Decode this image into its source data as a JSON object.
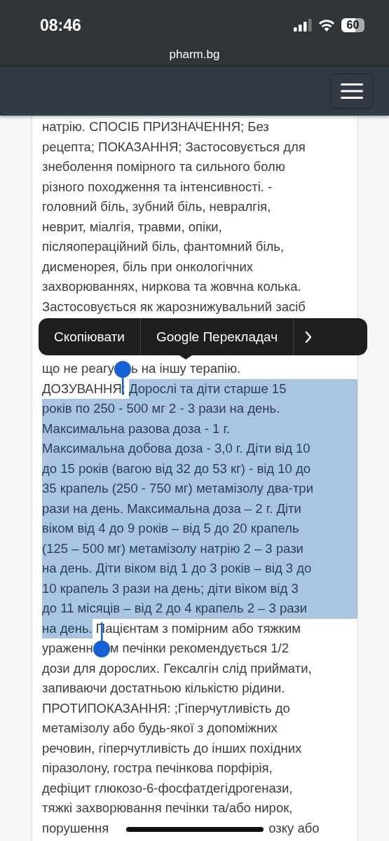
{
  "status_bar": {
    "time": "08:46",
    "battery": "60"
  },
  "browser": {
    "url": "pharm.bg"
  },
  "text_before_menu": [
    [
      {
        "text": "натрію. СПОСІБ ПРИЗНАЧЕННЯ; Без",
        "selected": false
      }
    ],
    [
      {
        "text": "рецепта; ПОКАЗАННЯ; Застосовується для",
        "selected": false
      }
    ],
    [
      {
        "text": "знеболення помірного та сильного болю",
        "selected": false
      }
    ],
    [
      {
        "text": "різного походження та інтенсивності. -",
        "selected": false
      }
    ],
    [
      {
        "text": "головний біль, зубний біль, невралгія,",
        "selected": false
      }
    ],
    [
      {
        "text": "неврит, міалгія, травми, опіки,",
        "selected": false
      }
    ],
    [
      {
        "text": "післяопераційний біль, фантомний біль,",
        "selected": false
      }
    ],
    [
      {
        "text": "дисменорея, біль при онкологічних",
        "selected": false
      }
    ],
    [
      {
        "text": "захворюваннях, ниркова та жовчна колька.",
        "selected": false
      }
    ],
    [
      {
        "text": "Застосовується як жарознижувальний засіб",
        "selected": false
      }
    ]
  ],
  "context_menu": {
    "items": [
      {
        "label": "Скопіювати"
      },
      {
        "label": "Google Перекладач"
      }
    ]
  },
  "text_after_menu": [
    [
      {
        "text": "що не реагу",
        "selected": false
      },
      {
        "text": "ь на іншу терапію.",
        "selected": false
      }
    ],
    [
      {
        "text": "ДОЗУВАННЯ; ",
        "selected": false
      },
      {
        "text": "Дорослі та діти старше 15",
        "selected": true
      }
    ],
    [
      {
        "text": "років по 250 - 500 мг 2 - 3 рази на день.",
        "selected": true
      }
    ],
    [
      {
        "text": "Максимальна разова доза - 1 г.",
        "selected": true
      }
    ],
    [
      {
        "text": "Максимальна добова доза - 3,0 г. Діти від 10",
        "selected": true
      }
    ],
    [
      {
        "text": "до 15 років (вагою від 32 до 53 кг) - від 10 до",
        "selected": true
      }
    ],
    [
      {
        "text": "35 крапель (250 - 750 мг) метамізолу два-три",
        "selected": true
      }
    ],
    [
      {
        "text": "рази на день. Максимальна доза – 2 г. Діти",
        "selected": true
      }
    ],
    [
      {
        "text": "віком від 4 до 9 років – від 5 до 20 крапель",
        "selected": true
      }
    ],
    [
      {
        "text": "(125 – 500 мг) метамізолу натрію 2 – 3 рази",
        "selected": true
      }
    ],
    [
      {
        "text": "на день. Діти віком від 1 до 3 років – від 3 до",
        "selected": true
      }
    ],
    [
      {
        "text": "10 крапель 3 рази на день; діти віком від 3",
        "selected": true
      }
    ],
    [
      {
        "text": "до 11 місяців – від 2 до 4 крапель 2 – 3 рази",
        "selected": true
      }
    ],
    [
      {
        "text": "на день.",
        "selected": true
      },
      {
        "text": " Пацієнтам з помірним або тяжким",
        "selected": false
      }
    ],
    [
      {
        "text": "ураженн",
        "selected": false
      },
      {
        "text": "м печінки рекомендується 1/2",
        "selected": false
      }
    ],
    [
      {
        "text": "дози для дорослих. Гексалгін слід приймати,",
        "selected": false
      }
    ],
    [
      {
        "text": "запиваючи достатньою кількістю рідини.",
        "selected": false
      }
    ],
    [
      {
        "text": "ПРОТИПОКАЗАННЯ: ;Гіперчутливість до",
        "selected": false
      }
    ],
    [
      {
        "text": "метамізолу або будь-якої з допоміжних",
        "selected": false
      }
    ],
    [
      {
        "text": "речовин, гіперчутливість до інших похідних",
        "selected": false
      }
    ],
    [
      {
        "text": "піразолону, гостра печінкова порфірія,",
        "selected": false
      }
    ],
    [
      {
        "text": "дефіцит глюкозо-6-фосфатдегідрогенази,",
        "selected": false
      }
    ],
    [
      {
        "text": "тяжкі захворювання печінки та/або нирок,",
        "selected": false
      }
    ],
    [
      {
        "text": "порушення",
        "selected": false
      },
      {
        "text": "озку або",
        "selected": false
      }
    ]
  ]
}
